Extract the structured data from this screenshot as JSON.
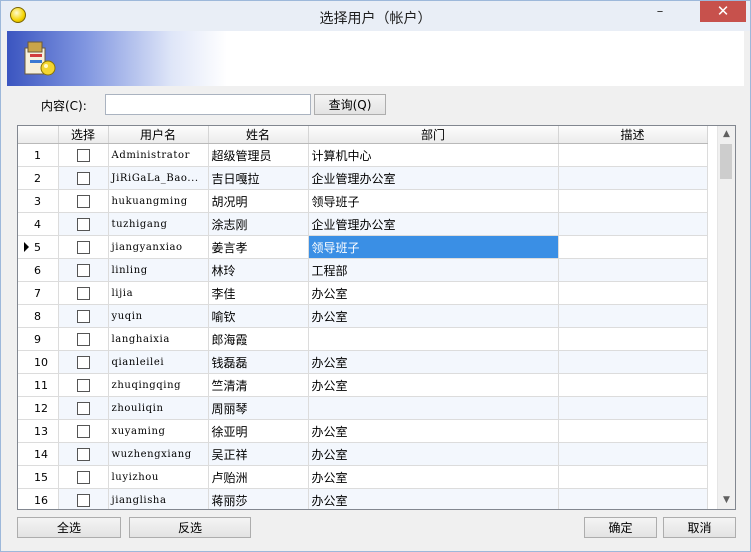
{
  "window": {
    "title": "选择用户（帐户）"
  },
  "controls": {
    "minimize": "–",
    "close": "✕"
  },
  "search": {
    "label": "内容(C):",
    "value": "",
    "button": "查询(Q)"
  },
  "table": {
    "columns": [
      "",
      "选择",
      "用户名",
      "姓名",
      "部门",
      "描述"
    ],
    "rows": [
      {
        "no": "1",
        "user": "Administrator",
        "name": "超级管理员",
        "dept": "计算机中心",
        "desc": ""
      },
      {
        "no": "2",
        "user": "JiRiGaLa_Bao...",
        "name": "吉日嘎拉",
        "dept": "企业管理办公室",
        "desc": ""
      },
      {
        "no": "3",
        "user": "hukuangming",
        "name": "胡况明",
        "dept": "领导班子",
        "desc": ""
      },
      {
        "no": "4",
        "user": "tuzhigang",
        "name": "涂志刚",
        "dept": "企业管理办公室",
        "desc": ""
      },
      {
        "no": "5",
        "user": "jiangyanxiao",
        "name": "姜言孝",
        "dept": "领导班子",
        "desc": ""
      },
      {
        "no": "6",
        "user": "linling",
        "name": "林玲",
        "dept": "工程部",
        "desc": ""
      },
      {
        "no": "7",
        "user": "lijia",
        "name": "李佳",
        "dept": "办公室",
        "desc": ""
      },
      {
        "no": "8",
        "user": "yuqin",
        "name": "喻钦",
        "dept": "办公室",
        "desc": ""
      },
      {
        "no": "9",
        "user": "langhaixia",
        "name": "郎海霞",
        "dept": "",
        "desc": ""
      },
      {
        "no": "10",
        "user": "qianleilei",
        "name": "钱磊磊",
        "dept": "办公室",
        "desc": ""
      },
      {
        "no": "11",
        "user": "zhuqingqing",
        "name": "竺清清",
        "dept": "办公室",
        "desc": ""
      },
      {
        "no": "12",
        "user": "zhouliqin",
        "name": "周丽琴",
        "dept": "",
        "desc": ""
      },
      {
        "no": "13",
        "user": "xuyaming",
        "name": "徐亚明",
        "dept": "办公室",
        "desc": ""
      },
      {
        "no": "14",
        "user": "wuzhengxiang",
        "name": "吴正祥",
        "dept": "办公室",
        "desc": ""
      },
      {
        "no": "15",
        "user": "luyizhou",
        "name": "卢贻洲",
        "dept": "办公室",
        "desc": ""
      },
      {
        "no": "16",
        "user": "jianglisha",
        "name": "蒋丽莎",
        "dept": "办公室",
        "desc": ""
      }
    ],
    "current_row": 5,
    "selected_cell": "dept"
  },
  "footer": {
    "select_all": "全选",
    "invert": "反选",
    "ok": "确定",
    "cancel": "取消"
  },
  "colors": {
    "selection": "#3a8fe5",
    "close_button": "#c7514c",
    "banner_gradient": "#3b55c0"
  }
}
